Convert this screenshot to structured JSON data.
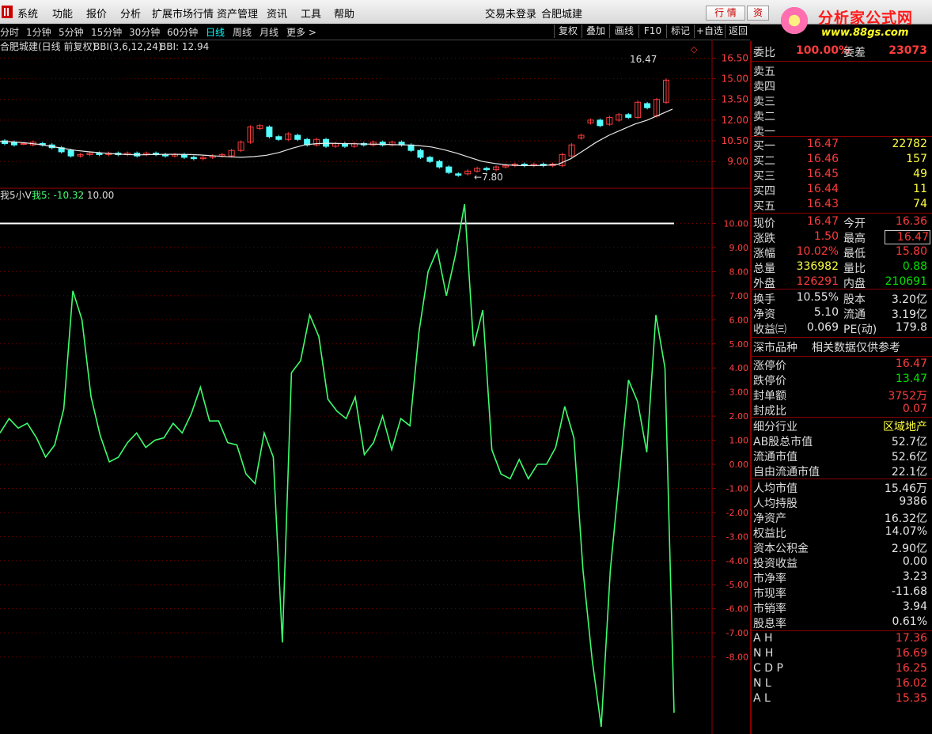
{
  "menubar": {
    "items": [
      "系统",
      "功能",
      "报价",
      "分析",
      "扩展市场行情",
      "资产管理",
      "资讯",
      "工具",
      "帮助"
    ],
    "login_status": "交易未登录",
    "stock_name": "合肥城建",
    "tab_quote": "行 情",
    "tab_info": "资"
  },
  "brand": {
    "title": "分析家公式网",
    "url": "www.88gs.com"
  },
  "periods": {
    "items": [
      "分时",
      "1分钟",
      "5分钟",
      "15分钟",
      "30分钟",
      "60分钟",
      "日线",
      "周线",
      "月线",
      "更多 >"
    ],
    "active": "日线"
  },
  "toolbar": {
    "items": [
      "复权",
      "叠加",
      "画线",
      "F10",
      "标记",
      "+自选",
      "返回"
    ]
  },
  "main_chart": {
    "header_name": "合肥城建(日线 前复权)",
    "indicator_label": "BBI(3,6,12,24)",
    "indicator_value": "BBI: 12.94",
    "high_marker": "16.47",
    "low_marker": "7.80",
    "price_axis": [
      "16.50",
      "15.00",
      "13.50",
      "12.00",
      "10.50",
      "9.00"
    ],
    "colors": {
      "up": "#ff3c3c",
      "down": "#54ffff",
      "bbi": "#e6e6e6"
    }
  },
  "sub_chart": {
    "name": "我5小V",
    "series_label": "我5: -10.32",
    "ref_label": ": 10.00",
    "ref_value": 10.0,
    "axis": [
      "10.00",
      "9.00",
      "8.00",
      "7.00",
      "6.00",
      "5.00",
      "4.00",
      "3.00",
      "2.00",
      "1.00",
      "0.00",
      "-1.00",
      "-2.00",
      "-3.00",
      "-4.00",
      "-5.00",
      "-6.00",
      "-7.00",
      "-8.00"
    ],
    "colors": {
      "line": "#3dff6e",
      "ref": "#ffffff"
    }
  },
  "chart_data": {
    "type": "line",
    "series": [
      {
        "name": "我5",
        "values": [
          1.3,
          1.9,
          1.5,
          1.7,
          1.1,
          0.3,
          0.8,
          2.3,
          7.2,
          6.0,
          2.8,
          1.2,
          0.1,
          0.3,
          0.9,
          1.3,
          0.7,
          1.0,
          1.1,
          1.7,
          1.3,
          2.1,
          3.2,
          1.8,
          1.8,
          0.9,
          0.8,
          -0.4,
          -0.8,
          1.3,
          0.3,
          -7.4,
          3.8,
          4.3,
          6.2,
          5.3,
          2.7,
          2.2,
          1.9,
          2.8,
          0.4,
          0.9,
          2.0,
          0.6,
          1.9,
          1.6,
          5.5,
          8.0,
          8.9,
          7.0,
          8.7,
          10.8,
          4.9,
          6.4,
          0.6,
          -0.4,
          -0.6,
          0.2,
          -0.6,
          0.0,
          0.0,
          0.7,
          2.4,
          1.1,
          -4.4,
          -8.1,
          -10.9,
          -4.4,
          -0.5,
          3.5,
          2.6,
          0.5,
          6.2,
          4.0,
          -10.32
        ]
      },
      {
        "name": "10.00",
        "values": [
          10.0
        ]
      }
    ],
    "ylim": [
      -11.2,
      11.2
    ]
  },
  "candles": [
    {
      "o": 10.5,
      "c": 10.3
    },
    {
      "o": 10.4,
      "c": 10.2
    },
    {
      "o": 10.3,
      "c": 10.3
    },
    {
      "o": 10.2,
      "c": 10.4
    },
    {
      "o": 10.3,
      "c": 10.2
    },
    {
      "o": 10.2,
      "c": 10.0
    },
    {
      "o": 10.0,
      "c": 9.7
    },
    {
      "o": 9.8,
      "c": 9.4
    },
    {
      "o": 9.4,
      "c": 9.5
    },
    {
      "o": 9.5,
      "c": 9.6
    },
    {
      "o": 9.6,
      "c": 9.5
    },
    {
      "o": 9.5,
      "c": 9.6
    },
    {
      "o": 9.6,
      "c": 9.5
    },
    {
      "o": 9.5,
      "c": 9.6
    },
    {
      "o": 9.6,
      "c": 9.4
    },
    {
      "o": 9.5,
      "c": 9.6
    },
    {
      "o": 9.6,
      "c": 9.5
    },
    {
      "o": 9.5,
      "c": 9.4
    },
    {
      "o": 9.4,
      "c": 9.5
    },
    {
      "o": 9.5,
      "c": 9.3
    },
    {
      "o": 9.3,
      "c": 9.2
    },
    {
      "o": 9.2,
      "c": 9.3
    },
    {
      "o": 9.3,
      "c": 9.4
    },
    {
      "o": 9.4,
      "c": 9.5
    },
    {
      "o": 9.4,
      "c": 9.8
    },
    {
      "o": 9.8,
      "c": 10.4
    },
    {
      "o": 10.4,
      "c": 11.5
    },
    {
      "o": 11.4,
      "c": 11.6
    },
    {
      "o": 11.5,
      "c": 10.8
    },
    {
      "o": 10.8,
      "c": 10.6
    },
    {
      "o": 10.6,
      "c": 11.0
    },
    {
      "o": 10.9,
      "c": 10.6
    },
    {
      "o": 10.6,
      "c": 10.2
    },
    {
      "o": 10.2,
      "c": 10.6
    },
    {
      "o": 10.6,
      "c": 10.1
    },
    {
      "o": 10.1,
      "c": 10.3
    },
    {
      "o": 10.3,
      "c": 10.1
    },
    {
      "o": 10.1,
      "c": 10.3
    },
    {
      "o": 10.3,
      "c": 10.2
    },
    {
      "o": 10.2,
      "c": 10.4
    },
    {
      "o": 10.4,
      "c": 10.2
    },
    {
      "o": 10.2,
      "c": 10.4
    },
    {
      "o": 10.4,
      "c": 10.2
    },
    {
      "o": 10.2,
      "c": 9.8
    },
    {
      "o": 9.8,
      "c": 9.3
    },
    {
      "o": 9.3,
      "c": 9.0
    },
    {
      "o": 9.0,
      "c": 8.6
    },
    {
      "o": 8.6,
      "c": 8.2
    },
    {
      "o": 8.1,
      "c": 8.0
    },
    {
      "o": 8.1,
      "c": 8.3
    },
    {
      "o": 8.3,
      "c": 8.5
    },
    {
      "o": 8.5,
      "c": 8.4
    },
    {
      "o": 8.4,
      "c": 8.6
    },
    {
      "o": 8.6,
      "c": 8.7
    },
    {
      "o": 8.7,
      "c": 8.8
    },
    {
      "o": 8.8,
      "c": 8.7
    },
    {
      "o": 8.7,
      "c": 8.8
    },
    {
      "o": 8.8,
      "c": 8.7
    },
    {
      "o": 8.7,
      "c": 8.8
    },
    {
      "o": 8.7,
      "c": 9.5
    },
    {
      "o": 9.4,
      "c": 10.2
    },
    {
      "o": 10.7,
      "c": 10.9
    },
    {
      "o": 11.8,
      "c": 12.0
    },
    {
      "o": 12.0,
      "c": 11.6
    },
    {
      "o": 11.7,
      "c": 12.2
    },
    {
      "o": 12.0,
      "c": 12.4
    },
    {
      "o": 12.4,
      "c": 12.2
    },
    {
      "o": 12.2,
      "c": 13.3
    },
    {
      "o": 13.2,
      "c": 12.9
    },
    {
      "o": 12.3,
      "c": 13.5
    },
    {
      "o": 13.3,
      "c": 14.9
    }
  ],
  "bbi": [
    10.45,
    10.42,
    10.35,
    10.25,
    10.1,
    9.95,
    9.8,
    9.7,
    9.62,
    9.55,
    9.5,
    9.48,
    9.5,
    9.52,
    9.52,
    9.5,
    9.46,
    9.4,
    9.34,
    9.3,
    9.35,
    9.45,
    9.65,
    9.95,
    10.2,
    10.3,
    10.32,
    10.3,
    10.28,
    10.26,
    10.25,
    10.22,
    10.2,
    10.15,
    10.05,
    9.85,
    9.6,
    9.3,
    9.0,
    8.85,
    8.75,
    8.7,
    8.7,
    8.72,
    8.8,
    9.2,
    9.8,
    10.4,
    10.9,
    11.3,
    11.7,
    12.0,
    12.4,
    12.8
  ],
  "quote": {
    "ratio": {
      "label": "委比",
      "value": "100.00%",
      "diff_label": "委差",
      "diff_value": "23073"
    },
    "asks": [
      {
        "label": "卖五"
      },
      {
        "label": "卖四"
      },
      {
        "label": "卖三"
      },
      {
        "label": "卖二"
      },
      {
        "label": "卖一"
      }
    ],
    "bids": [
      {
        "label": "买一",
        "price": "16.47",
        "vol": "22782"
      },
      {
        "label": "买二",
        "price": "16.46",
        "vol": "157"
      },
      {
        "label": "买三",
        "price": "16.45",
        "vol": "49"
      },
      {
        "label": "买四",
        "price": "16.44",
        "vol": "11"
      },
      {
        "label": "买五",
        "price": "16.43",
        "vol": "74"
      }
    ],
    "stats": [
      {
        "l1": "现价",
        "v1": "16.47",
        "c1": "red",
        "l2": "今开",
        "v2": "16.36",
        "c2": "red"
      },
      {
        "l1": "涨跌",
        "v1": "1.50",
        "c1": "red",
        "l2": "最高",
        "v2": "16.47",
        "c2": "red"
      },
      {
        "l1": "涨幅",
        "v1": "10.02%",
        "c1": "red",
        "l2": "最低",
        "v2": "15.80",
        "c2": "red"
      },
      {
        "l1": "总量",
        "v1": "336982",
        "c1": "yel",
        "l2": "量比",
        "v2": "0.88",
        "c2": "grn"
      },
      {
        "l1": "外盘",
        "v1": "126291",
        "c1": "red",
        "l2": "内盘",
        "v2": "210691",
        "c2": "grn"
      }
    ],
    "stats2": [
      {
        "l1": "换手",
        "v1": "10.55%",
        "l2": "股本",
        "v2": "3.20亿"
      },
      {
        "l1": "净资",
        "v1": "5.10",
        "l2": "流通",
        "v2": "3.19亿"
      },
      {
        "l1": "收益㈢",
        "v1": "0.069",
        "l2": "PE(动)",
        "v2": "179.8"
      }
    ],
    "market_title": "深市品种",
    "market_note": "相关数据仅供参考",
    "limits": [
      {
        "label": "涨停价",
        "value": "16.47",
        "c": "red"
      },
      {
        "label": "跌停价",
        "value": "13.47",
        "c": "grn"
      },
      {
        "label": "封单额",
        "value": "3752万",
        "c": "red"
      },
      {
        "label": "封成比",
        "value": "0.07",
        "c": "red"
      }
    ],
    "fundamentals": [
      {
        "label": "细分行业",
        "value": "区域地产"
      },
      {
        "label": "AB股总市值",
        "value": "52.7亿"
      },
      {
        "label": "流通市值",
        "value": "52.6亿"
      },
      {
        "label": "自由流通市值",
        "value": "22.1亿"
      }
    ],
    "per_share": [
      {
        "label": "人均市值",
        "value": "15.46万"
      },
      {
        "label": "人均持股",
        "value": "9386"
      },
      {
        "label": "净资产",
        "value": "16.32亿"
      },
      {
        "label": "权益比",
        "value": "14.07%"
      },
      {
        "label": "资本公积金",
        "value": "2.90亿"
      },
      {
        "label": "投资收益",
        "value": "0.00"
      },
      {
        "label": "市净率",
        "value": "3.23"
      },
      {
        "label": "市现率",
        "value": "-11.68"
      },
      {
        "label": "市销率",
        "value": "3.94"
      },
      {
        "label": "股息率",
        "value": "0.61%"
      }
    ],
    "pivots": [
      {
        "label": "A H",
        "value": "17.36"
      },
      {
        "label": "N H",
        "value": "16.69"
      },
      {
        "label": "C D P",
        "value": "16.25"
      },
      {
        "label": "N L",
        "value": "16.02"
      },
      {
        "label": "A L",
        "value": "15.35"
      }
    ]
  }
}
